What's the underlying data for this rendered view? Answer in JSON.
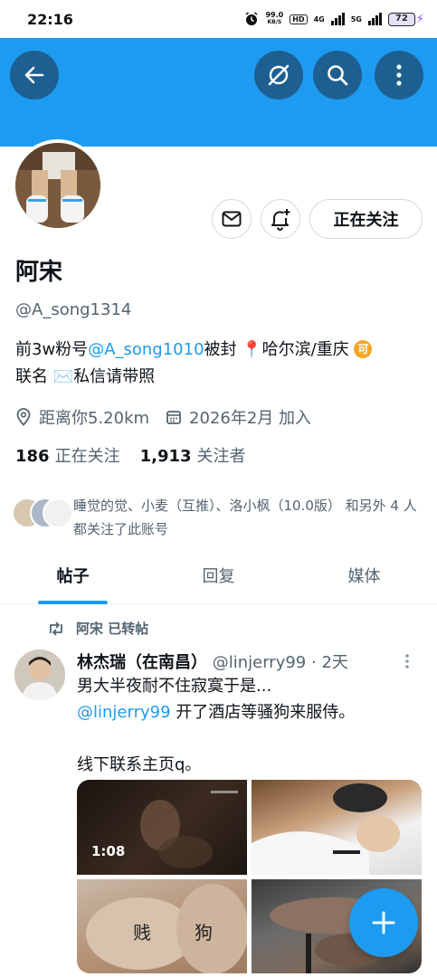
{
  "status_bar": {
    "time": "22:16",
    "net_speed_value": "99.0",
    "net_speed_unit": "KB/S",
    "hd_label": "HD",
    "network_4g": "4G",
    "network_5g": "5G",
    "battery": "72"
  },
  "header": {
    "back_icon": "arrow-left-icon",
    "grok_icon": "grok-icon",
    "search_icon": "search-icon",
    "more_icon": "more-vertical-icon",
    "banner_color": "#1d9bf0"
  },
  "profile": {
    "name": "阿宋",
    "handle": "@A_song1314",
    "bio_part1": "前3w粉号",
    "bio_link": "@A_song1010",
    "bio_part2": "被封 📍哈尔滨/重庆 ",
    "bio_badge": "可",
    "bio_part3": "联名 ✉️私信请带照",
    "location": "距离你5.20km",
    "joined": "2026年2月 加入",
    "following_count": "186",
    "following_label": "正在关注",
    "followers_count": "1,913",
    "followers_label": "关注者",
    "followed_by": "睡觉的觉、小麦（互推）、洛小枫（10.0版） 和另外 4 人 都关注了此账号",
    "follow_button_label": "正在关注"
  },
  "tabs": [
    {
      "label": "帖子",
      "active": true
    },
    {
      "label": "回复",
      "active": false
    },
    {
      "label": "媒体",
      "active": false
    }
  ],
  "tweet": {
    "repost_label": "阿宋 已转帖",
    "author_name": "林杰瑞（在南昌）",
    "author_handle": "@linjerry99",
    "time": "· 2天",
    "line1": "男大半夜耐不住寂寞于是...",
    "mention": "@linjerry99",
    "line2": " 开了酒店等骚狗来服侍。",
    "line3": "线下联系主页q。",
    "media_duration": "1:08"
  },
  "fab": {
    "icon": "plus-icon"
  },
  "accent_color": "#1d9bf0"
}
